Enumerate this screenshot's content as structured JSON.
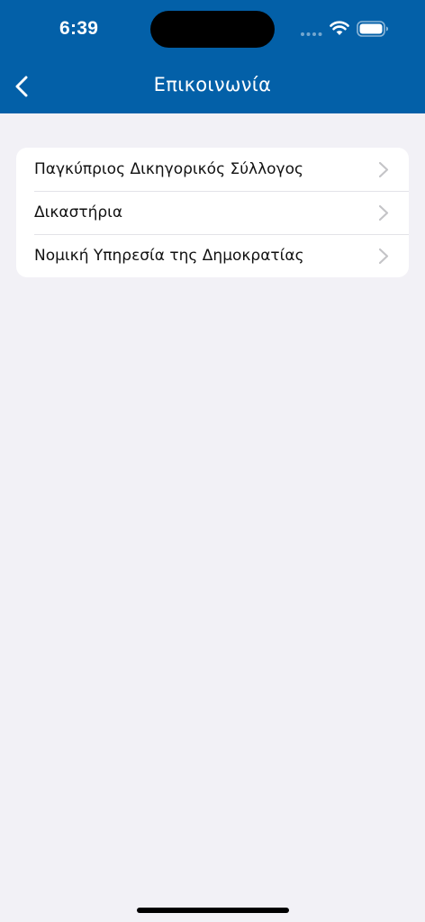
{
  "status_bar": {
    "time": "6:39",
    "icons": [
      "signal-dots-icon",
      "wifi-icon",
      "battery-icon"
    ]
  },
  "nav": {
    "title": "Επικοινωνία",
    "back_icon": "chevron-left-icon"
  },
  "list": {
    "items": [
      {
        "label": "Παγκύπριος Δικηγορικός Σύλλογος",
        "icon": "chevron-right-icon"
      },
      {
        "label": "Δικαστήρια",
        "icon": "chevron-right-icon"
      },
      {
        "label": "Νομική Υπηρεσία της Δημοκρατίας",
        "icon": "chevron-right-icon"
      }
    ]
  },
  "colors": {
    "header_bg": "#0360a8",
    "page_bg": "#f2f1f6",
    "card_bg": "#ffffff",
    "chevron": "#c4c4c7",
    "separator": "#e3e3e8"
  }
}
